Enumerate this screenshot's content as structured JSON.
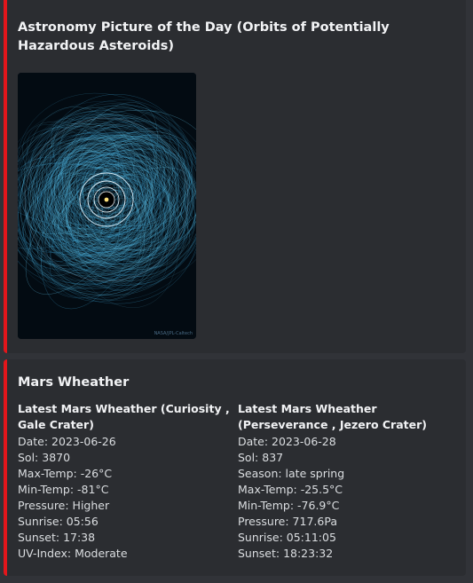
{
  "apod_embed": {
    "title": "Astronomy Picture of the Day (Orbits of Potentially Hazardous Asteroids)",
    "image_credit": "NASA/JPL-Caltech",
    "accent_color": "#e3161b"
  },
  "mars_embed": {
    "title": "Mars Wheather",
    "accent_color": "#e3161b",
    "fields": [
      {
        "name": "Latest Mars Wheather (Curiosity , Gale Crater)",
        "lines": [
          "Date: 2023-06-26",
          "Sol: 3870",
          "Max-Temp: -26°C",
          "Min-Temp: -81°C",
          "Pressure: Higher",
          "Sunrise: 05:56",
          "Sunset: 17:38",
          "UV-Index: Moderate"
        ]
      },
      {
        "name": "Latest Mars Wheather (Perseverance , Jezero Crater)",
        "lines": [
          "Date: 2023-06-28",
          "Sol: 837",
          "Season: late spring",
          "Max-Temp: -25.5°C",
          "Min-Temp: -76.9°C",
          "Pressure: 717.6Pa",
          "Sunrise: 05:11:05",
          "Sunset: 18:23:32"
        ]
      }
    ]
  }
}
